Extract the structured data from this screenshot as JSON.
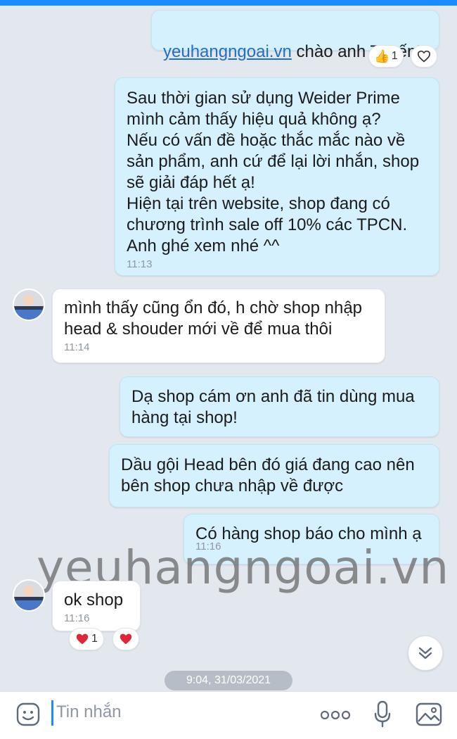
{
  "messages": [
    {
      "id": "m1",
      "side": "me",
      "link": "yeuhangngoai.vn",
      "text": " chào anh Tuyến!"
    },
    {
      "id": "m2",
      "side": "me",
      "text": "Sau thời gian sử dụng Weider Prime\nmình cảm thấy hiệu quả không ạ?\nNếu có vấn đề hoặc thắc mắc nào về\nsản phẩm, anh cứ để lại lời nhắn, shop\nsẽ giải đáp hết ạ!\nHiện tại trên website, shop đang có\nchương trình sale off 10% các TPCN.\nAnh ghé xem nhé ^^",
      "time": "11:13"
    },
    {
      "id": "m3",
      "side": "them",
      "text": "mình thấy cũng ổn đó, h chờ shop nhập\nhead & shouder mới về để mua thôi",
      "time": "11:14"
    },
    {
      "id": "m4",
      "side": "me",
      "text": "Dạ shop cám ơn anh đã tin dùng mua\nhàng tại shop!"
    },
    {
      "id": "m5",
      "side": "me",
      "text": "Dầu gội Head bên đó giá đang cao nên\nbên shop chưa nhập về được"
    },
    {
      "id": "m6",
      "side": "me",
      "text": "Có hàng shop báo cho mình ạ",
      "time": "11:16"
    },
    {
      "id": "m7",
      "side": "them",
      "text": "ok shop",
      "time": "11:16"
    }
  ],
  "reactions": {
    "m1_like_count": "1",
    "m7_heart_count": "1"
  },
  "watermark": "yeuhangngoai.vn",
  "date_divider": "9:04, 31/03/2021",
  "composer": {
    "placeholder": "Tin nhắn"
  },
  "colors": {
    "accent": "#1a8cff",
    "my_bubble": "#d5f1fd",
    "their_bubble": "#ffffff",
    "background": "#e3e8ef",
    "heart": "#e0243a"
  },
  "icons": [
    "thumbs-up-icon",
    "heart-outline-icon",
    "heart-icon",
    "chevron-double-down-icon",
    "sticker-icon",
    "more-icon",
    "microphone-icon",
    "image-icon"
  ]
}
